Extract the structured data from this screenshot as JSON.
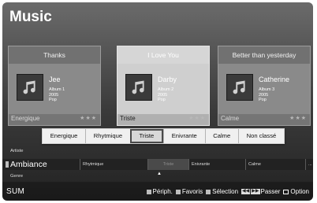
{
  "app": {
    "title": "Music",
    "brand": "SUM"
  },
  "cards": [
    {
      "song": "Thanks",
      "artist": "Jee",
      "album": "Album 1",
      "year": "2005",
      "genre": "Pop",
      "mood": "Energique",
      "stars": "★★★",
      "selected": false
    },
    {
      "song": "I Love You",
      "artist": "Darby",
      "album": "Album 2",
      "year": "2005",
      "genre": "Pop",
      "mood": "Triste",
      "stars": "★★★",
      "selected": true
    },
    {
      "song": "Better than yesterday",
      "artist": "Catherine",
      "album": "Album 3",
      "year": "2005",
      "genre": "Pop",
      "mood": "Calme",
      "stars": "★★★",
      "selected": false
    }
  ],
  "mood_menu": {
    "options": [
      "Energique",
      "Rhytmique",
      "Triste",
      "Enivrante",
      "Calme",
      "Non classé"
    ],
    "selected": "Triste"
  },
  "categories": {
    "above": "Artiste",
    "current": "Ambiance",
    "below": "Genre",
    "bar_items": [
      "Rhytmique",
      "Triste",
      "Enivrante",
      "Calme",
      "..."
    ],
    "bar_selected": "Triste"
  },
  "status": {
    "hints": [
      {
        "label": "Périph.",
        "color": "#bdbdbd",
        "icon": "gray-square-icon"
      },
      {
        "label": "Favoris",
        "color": "#bdbdbd",
        "icon": "gray-square-icon"
      },
      {
        "label": "Sélection",
        "color": "#bdbdbd",
        "icon": "gray-square-icon"
      },
      {
        "label": "Passer",
        "icon": "skip-icon"
      },
      {
        "label": "Option",
        "icon": "option-icon"
      }
    ]
  }
}
